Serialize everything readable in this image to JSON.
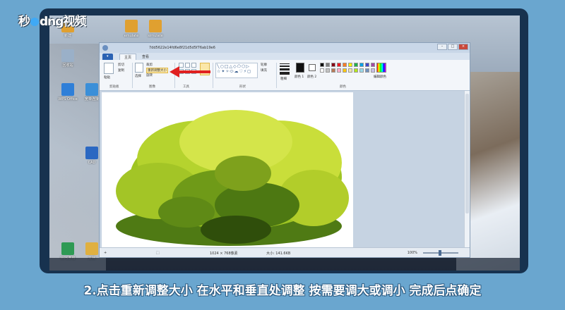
{
  "watermark": {
    "text_before": "秒",
    "text_after": "ng视频",
    "letter": "d"
  },
  "desktop": {
    "icons": [
      {
        "label": "新建",
        "color": "#e0a030"
      },
      {
        "label": "回收站",
        "color": "#9ab0c8"
      },
      {
        "label": "WPS Office",
        "color": "#2f7fd8"
      },
      {
        "label": "宽带连接",
        "color": "#3b8fd8"
      },
      {
        "label": "CAD",
        "color": "#2b68c2"
      },
      {
        "label": "WPS表格",
        "color": "#2e9a54"
      },
      {
        "label": "文档",
        "color": "#e0b040"
      },
      {
        "label": "emulate",
        "color": "#e0a030"
      },
      {
        "label": "simulate",
        "color": "#e0a030"
      }
    ]
  },
  "paint": {
    "title": "7dd5622e14fd6e8f21d5d5f76ab19e6",
    "tabs": [
      "",
      "主页",
      "查看"
    ],
    "ribbon": {
      "clipboard": {
        "label": "剪贴板",
        "paste": "粘贴",
        "cut": "剪切",
        "copy": "复制"
      },
      "image": {
        "label": "图像",
        "select": "选择",
        "crop": "裁剪",
        "resize": "重新调整大小",
        "rotate": "旋转"
      },
      "tools": {
        "label": "工具"
      },
      "shapes": {
        "label": "形状",
        "outline": "轮廓",
        "fill": "填充"
      },
      "size": {
        "label": "粗细"
      },
      "colors": {
        "label": "颜色",
        "color1": "颜色 1",
        "color2": "颜色 2",
        "edit": "编辑颜色",
        "palette": [
          "#000000",
          "#7f7f7f",
          "#880015",
          "#ed1c24",
          "#ff7f27",
          "#fff200",
          "#22b14c",
          "#00a2e8",
          "#3f48cc",
          "#a349a4",
          "#ffffff",
          "#c3c3c3",
          "#b97a57",
          "#ffaec9",
          "#ffc90e",
          "#efe4b0",
          "#b5e61d",
          "#99d9ea",
          "#7092be",
          "#c8bfe7"
        ]
      }
    },
    "status": {
      "dimensions": "1024 × 768像素",
      "size": "大小: 141.6KB",
      "zoom": "100%"
    }
  },
  "caption": "2.点击重新调整大小 在水平和垂直处调整 按需要调大或调小 完成后点确定"
}
